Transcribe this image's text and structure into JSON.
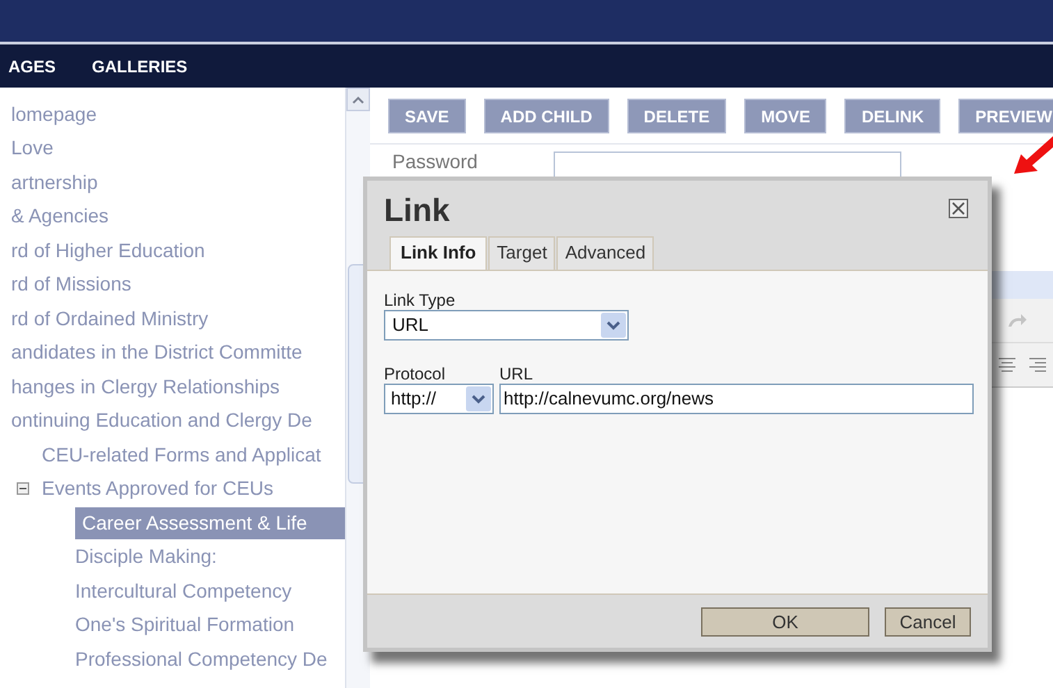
{
  "top_nav": {
    "items": [
      {
        "label": "AGES"
      },
      {
        "label": "GALLERIES"
      }
    ]
  },
  "page_tree": {
    "items": [
      {
        "label": "lomepage",
        "selected": false
      },
      {
        "label": "Love",
        "selected": false
      },
      {
        "label": "artnership",
        "selected": false
      },
      {
        "label": "& Agencies",
        "selected": false
      },
      {
        "label": "rd of Higher Education",
        "selected": false
      },
      {
        "label": "rd of Missions",
        "selected": false
      },
      {
        "label": "rd of Ordained Ministry",
        "selected": false
      },
      {
        "label": "andidates in the District Committe",
        "selected": false
      },
      {
        "label": "hanges in Clergy Relationships",
        "selected": false
      },
      {
        "label": "ontinuing Education and Clergy De",
        "selected": false,
        "children": [
          {
            "label": "CEU-related Forms and Applicat",
            "selected": false
          },
          {
            "label": "Events Approved for CEUs",
            "selected": false,
            "expanded": true,
            "children": [
              {
                "label": "Career Assessment & Life",
                "selected": true
              },
              {
                "label": "Disciple Making:",
                "selected": false
              },
              {
                "label": "Intercultural Competency",
                "selected": false
              },
              {
                "label": "One's Spiritual Formation",
                "selected": false
              },
              {
                "label": "Professional Competency De",
                "selected": false
              }
            ]
          }
        ]
      }
    ]
  },
  "toolbar": {
    "buttons": [
      {
        "label": "SAVE"
      },
      {
        "label": "ADD CHILD"
      },
      {
        "label": "DELETE"
      },
      {
        "label": "MOVE"
      },
      {
        "label": "DELINK"
      },
      {
        "label": "PREVIEW"
      }
    ]
  },
  "form": {
    "password_label": "Password"
  },
  "dialog": {
    "title": "Link",
    "tabs": [
      {
        "label": "Link Info",
        "selected": true
      },
      {
        "label": "Target",
        "selected": false
      },
      {
        "label": "Advanced",
        "selected": false
      }
    ],
    "link_type": {
      "label": "Link Type",
      "value": "URL"
    },
    "protocol": {
      "label": "Protocol",
      "value": "http://"
    },
    "url": {
      "label": "URL",
      "value": "http://calnevumc.org/news"
    },
    "buttons": [
      {
        "label": "OK"
      },
      {
        "label": "Cancel"
      }
    ]
  }
}
